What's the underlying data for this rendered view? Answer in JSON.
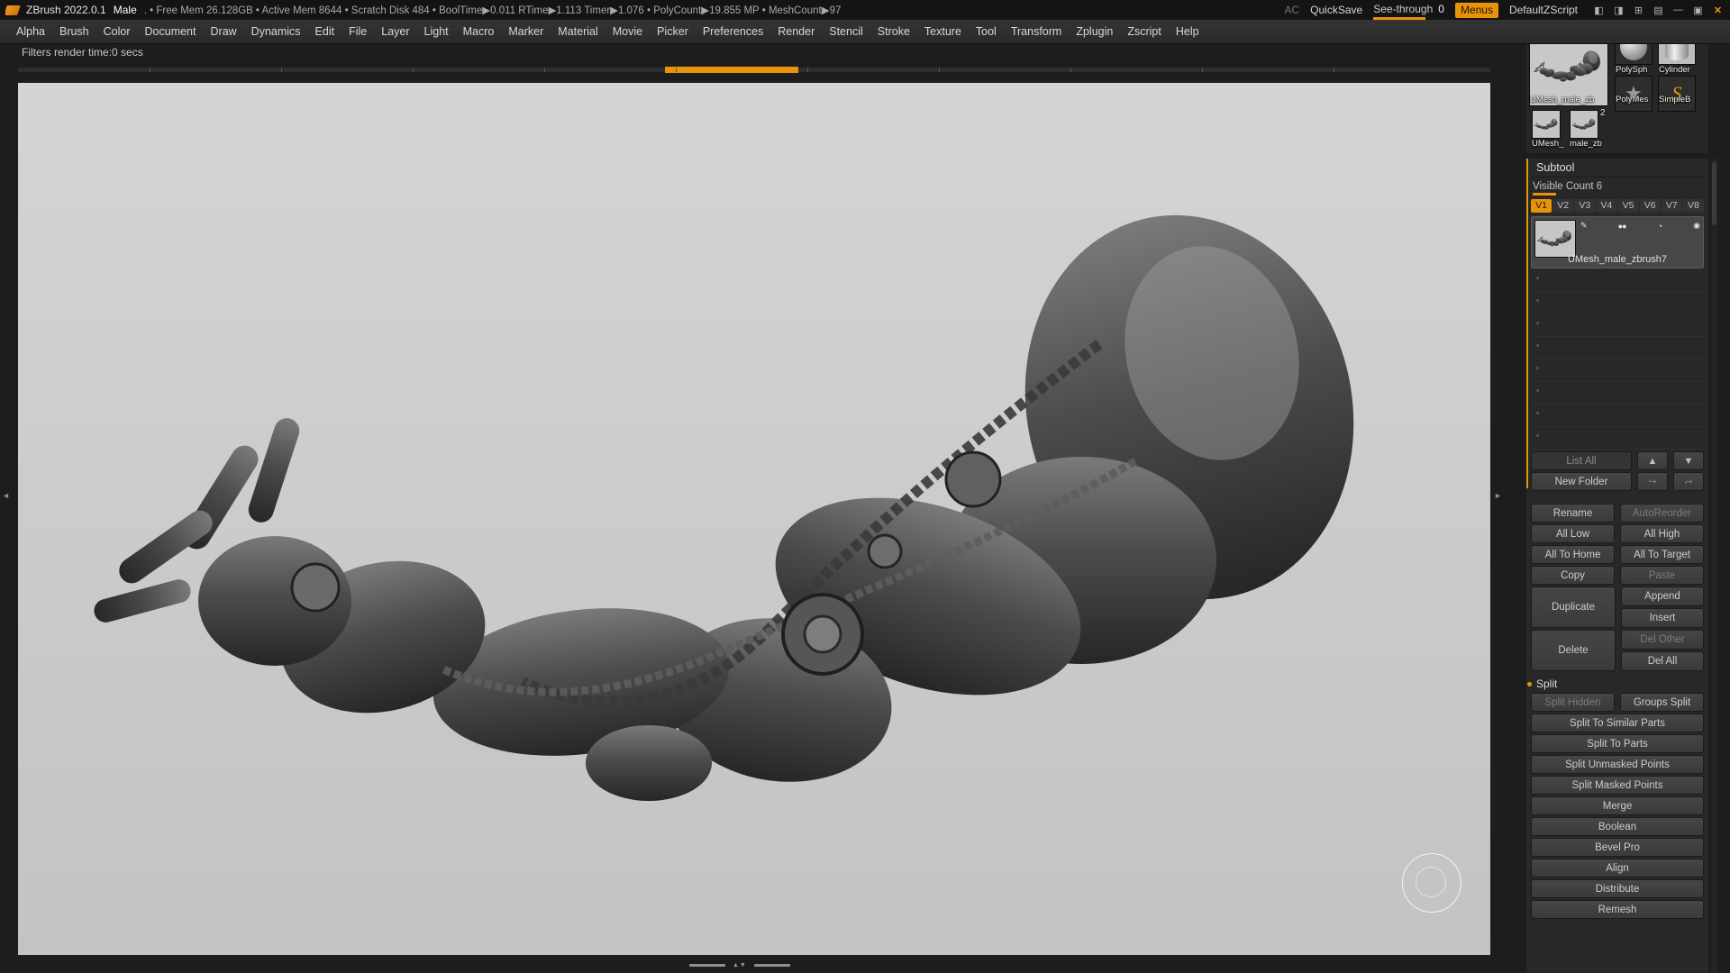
{
  "colors": {
    "accent_orange": "#e8930c"
  },
  "titlebar": {
    "app_title": "ZBrush 2022.0.1",
    "doc_title": "Male",
    "stats": ". • Free Mem 26.128GB • Active Mem 8644 • Scratch Disk 484 •  BoolTime▶0.011 RTime▶1.113 Timer▶1.076 • PolyCount▶19.855 MP  • MeshCount▶97",
    "ac_label": "AC",
    "quicksave_label": "QuickSave",
    "seethrough_label": "See-through",
    "seethrough_value": "0",
    "menus_label": "Menus",
    "zscript_label": "DefaultZScript",
    "window_icons": [
      {
        "name": "tray-left-icon",
        "glyph": "◧"
      },
      {
        "name": "tray-right-icon",
        "glyph": "◨"
      },
      {
        "name": "add-document-icon",
        "glyph": "⊞"
      },
      {
        "name": "layout-icon",
        "glyph": "▤"
      },
      {
        "name": "minimize-icon",
        "glyph": "—"
      },
      {
        "name": "restore-icon",
        "glyph": "▣"
      },
      {
        "name": "close-icon",
        "glyph": "✕"
      }
    ]
  },
  "menubar": {
    "items": [
      "Alpha",
      "Brush",
      "Color",
      "Document",
      "Draw",
      "Dynamics",
      "Edit",
      "File",
      "Layer",
      "Light",
      "Macro",
      "Marker",
      "Material",
      "Movie",
      "Picker",
      "Preferences",
      "Render",
      "Stencil",
      "Stroke",
      "Texture",
      "Tool",
      "Transform",
      "Zplugin",
      "Zscript",
      "Help"
    ]
  },
  "status": {
    "filters_text": "Filters render time:0 secs"
  },
  "tool_shelf": {
    "big_thumb_label": "UMesh_male_zb",
    "thumbs": [
      {
        "name": "polysphere-tool",
        "label": "PolySph"
      },
      {
        "name": "cylinder-tool",
        "label": "Cylinder"
      },
      {
        "name": "polymesh-star-tool",
        "label": "PolyMes"
      },
      {
        "name": "simple-brush-tool",
        "label": "SimpleB",
        "glyph": "S"
      }
    ],
    "star_glyph": "★",
    "small_thumbs": [
      {
        "label": "UMesh_"
      },
      {
        "label": "male_zb",
        "badge": "2"
      }
    ]
  },
  "subtool": {
    "header": "Subtool",
    "visible_count": "Visible Count 6",
    "tabs": [
      "V1",
      "V2",
      "V3",
      "V4",
      "V5",
      "V6",
      "V7",
      "V8"
    ],
    "active_tab_index": 0,
    "selected_item": "UMesh_male_zbrush7",
    "item_icons": [
      {
        "name": "edit-pencil-icon",
        "glyph": "✎"
      },
      {
        "name": "polypaint-dots-icon",
        "glyph": "●●"
      },
      {
        "name": "mask-icon",
        "glyph": "◔"
      },
      {
        "name": "visibility-eye-icon",
        "glyph": "◉"
      }
    ],
    "list_all": "List All",
    "icons": {
      "move_up": "▲",
      "move_down": "▼",
      "folder_arrow": "↪"
    },
    "new_folder": "New Folder",
    "pair_rows": [
      {
        "left": "Rename",
        "right": "AutoReorder",
        "left_disabled": false,
        "right_disabled": true
      },
      {
        "left": "All Low",
        "right": "All High",
        "left_disabled": false,
        "right_disabled": false
      },
      {
        "left": "All To Home",
        "right": "All To Target",
        "left_disabled": false,
        "right_disabled": false
      },
      {
        "left": "Copy",
        "right": "Paste",
        "left_disabled": false,
        "right_disabled": true
      }
    ],
    "duplicate": "Duplicate",
    "append": "Append",
    "insert": "Insert",
    "delete": "Delete",
    "del_other": "Del Other",
    "del_all": "Del All",
    "split_header": "Split",
    "split_hidden": "Split Hidden",
    "groups_split": "Groups Split",
    "wide_buttons": [
      "Split To Similar Parts",
      "Split To Parts",
      "Split Unmasked Points",
      "Split Masked Points",
      "Merge",
      "Boolean",
      "Bevel Pro",
      "Align",
      "Distribute",
      "Remesh"
    ]
  }
}
